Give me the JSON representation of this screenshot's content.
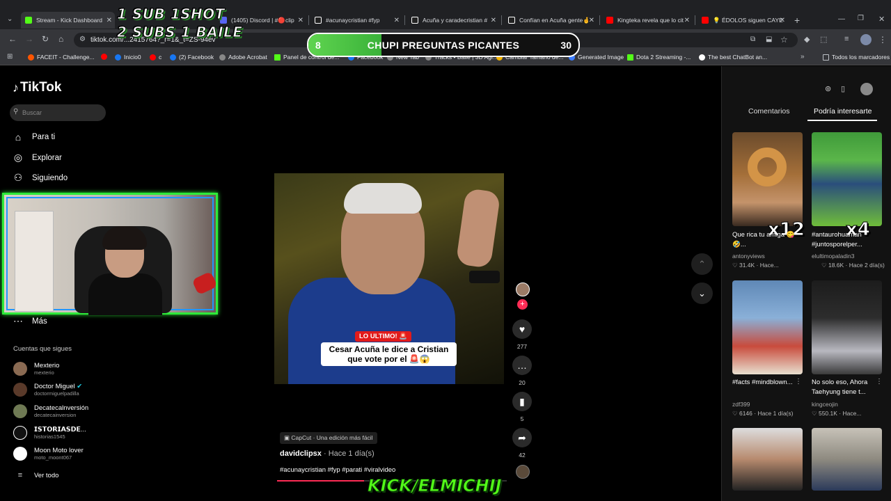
{
  "browser": {
    "tabs": [
      {
        "label": "Stream - Kick Dashboard",
        "color": "#53fc18"
      },
      {
        "label": "(1405) Discord | #🔴clip",
        "color": "#5865f2"
      },
      {
        "label": "#acunaycristian #fyp",
        "color": "#ffffff"
      },
      {
        "label": "Acuña y caradecristian #",
        "color": "#ffffff"
      },
      {
        "label": "Confían en Acuña gente🤞",
        "color": "#ffffff"
      },
      {
        "label": "Kingteka revela que lo cit",
        "color": "#ff0000"
      },
      {
        "label": "💡 ÉDOLOS siguen CAYE",
        "color": "#ff0000"
      }
    ],
    "url": "tiktok.com/...2415764?_r=1&_t=ZS-94ev",
    "bookmarks": [
      "FACEIT - Challenge...",
      "Inicio0",
      "c",
      "(2) Facebook",
      "Adobe Acrobat",
      "Panel de control de...",
      "Facebook",
      "New Tab",
      "Tracks • Baile | 3D Agi...",
      "Cambiar Tamaño de...",
      "Generated Image",
      "Dota 2 Streaming -...",
      "The best ChatBot an..."
    ],
    "bookmarks_all": "Todos los marcadores"
  },
  "overlay": {
    "sub_line1": "1 SUB 1SHOT",
    "sub_line2": "2 SUBS 1 BAILE",
    "poll_left": "8",
    "poll_title": "CHUPI PREGUNTAS PICANTES",
    "poll_right": "30",
    "poll_progress": 0.27,
    "kick_handle": "KICK/ELMICHIJ"
  },
  "sidebar": {
    "logo": "TikTok",
    "search_placeholder": "Buscar",
    "nav": [
      {
        "label": "Para ti",
        "icon": "home-icon"
      },
      {
        "label": "Explorar",
        "icon": "compass-icon"
      },
      {
        "label": "Siguiendo",
        "icon": "following-icon"
      },
      {
        "label": "Más",
        "icon": "more-icon"
      }
    ],
    "following_header": "Cuentas que sigues",
    "following": [
      {
        "name": "Mexterio",
        "handle": "mexterio"
      },
      {
        "name": "Doctor Miguel",
        "handle": "doctormiguelpadilla",
        "verified": true
      },
      {
        "name": "Decatecalnversión",
        "handle": "decatecainversion"
      },
      {
        "name": "𝗜𝗦𝗧𝗢𝗥𝗜𝗔𝗦𝗗𝗘...",
        "handle": "historias1545"
      },
      {
        "name": "Moon Moto lover",
        "handle": "moto_moont067"
      }
    ],
    "see_all": "Ver todo"
  },
  "video": {
    "badge": "LO ULTIMO! 🚨",
    "caption": "Cesar Acuña le dice a Cristian que vote por el 🚨😱",
    "capcut": "CapCut · Una edición más fácil",
    "author": "davidclipsx",
    "time": " · Hace 1 día(s)",
    "hashtags": "#acunaycristian #fyp #parati #viralvideo",
    "progress": 0.38,
    "likes": "277",
    "comments": "20",
    "saves": "5",
    "shares": "42"
  },
  "right_panel": {
    "tab_comments": "Comentarios",
    "tab_interest": "Podría interesarte",
    "cards": [
      {
        "title": "Que rica tu amiga 😋🤣...",
        "user": "antonyviews",
        "meta": "♡ 31.4K · Hace...",
        "overlay": "x12"
      },
      {
        "title": "#antaurohuaman #juntosporelper...",
        "user": "elultimopaladin3",
        "meta": "♡ 18.6K · Hace 2 día(s)",
        "overlay": "x4"
      },
      {
        "title": "#facts #mindblown...",
        "user": "zdf399",
        "meta": "♡ 6146 · Hace 1 día(s)",
        "overlay": ""
      },
      {
        "title": "No solo eso, Ahora Taehyung tiene t...",
        "user": "kingceojin",
        "meta": "♡ 550.1K · Hace...",
        "overlay": ""
      }
    ]
  }
}
